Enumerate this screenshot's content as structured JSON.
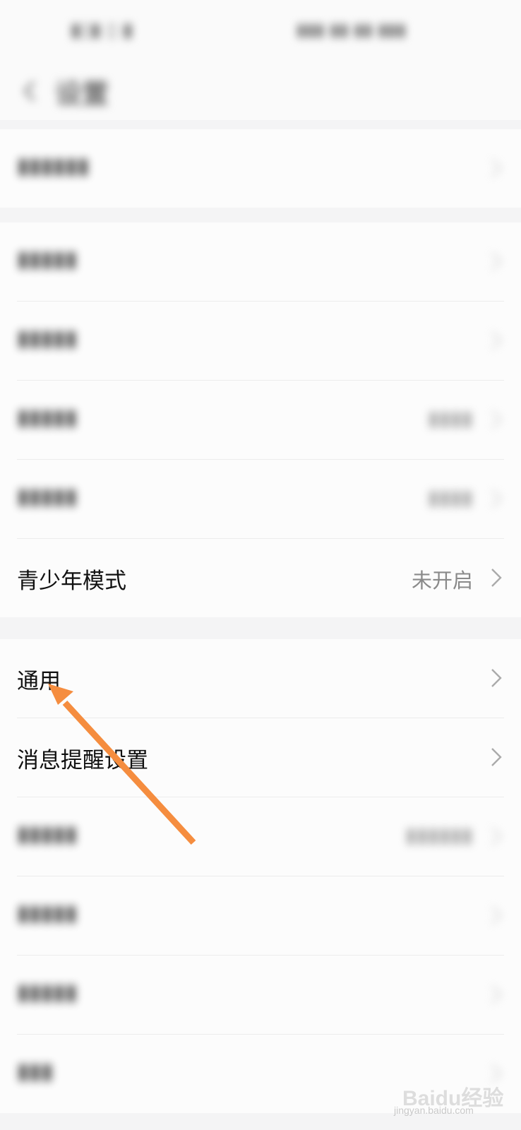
{
  "status_bar": {
    "left_text": "",
    "right_text": ""
  },
  "header": {
    "title": "设置"
  },
  "group1": [
    {
      "label": "",
      "value": ""
    }
  ],
  "group2": [
    {
      "label": "",
      "value": ""
    },
    {
      "label": "",
      "value": ""
    },
    {
      "label": "",
      "value": ""
    },
    {
      "label": "",
      "value": ""
    },
    {
      "label": "青少年模式",
      "value": "未开启"
    }
  ],
  "group3": [
    {
      "label": "通用",
      "value": ""
    },
    {
      "label": "消息提醒设置",
      "value": ""
    },
    {
      "label": "",
      "value": ""
    },
    {
      "label": "",
      "value": ""
    },
    {
      "label": "",
      "value": ""
    },
    {
      "label": "",
      "value": ""
    }
  ],
  "annotation": {
    "color": "#f58d3f"
  },
  "watermark": {
    "brand": "Baidu经验",
    "url": "jingyan.baidu.com"
  },
  "icons": {
    "back": "back-chevron-icon",
    "row": "chevron-right-icon"
  }
}
